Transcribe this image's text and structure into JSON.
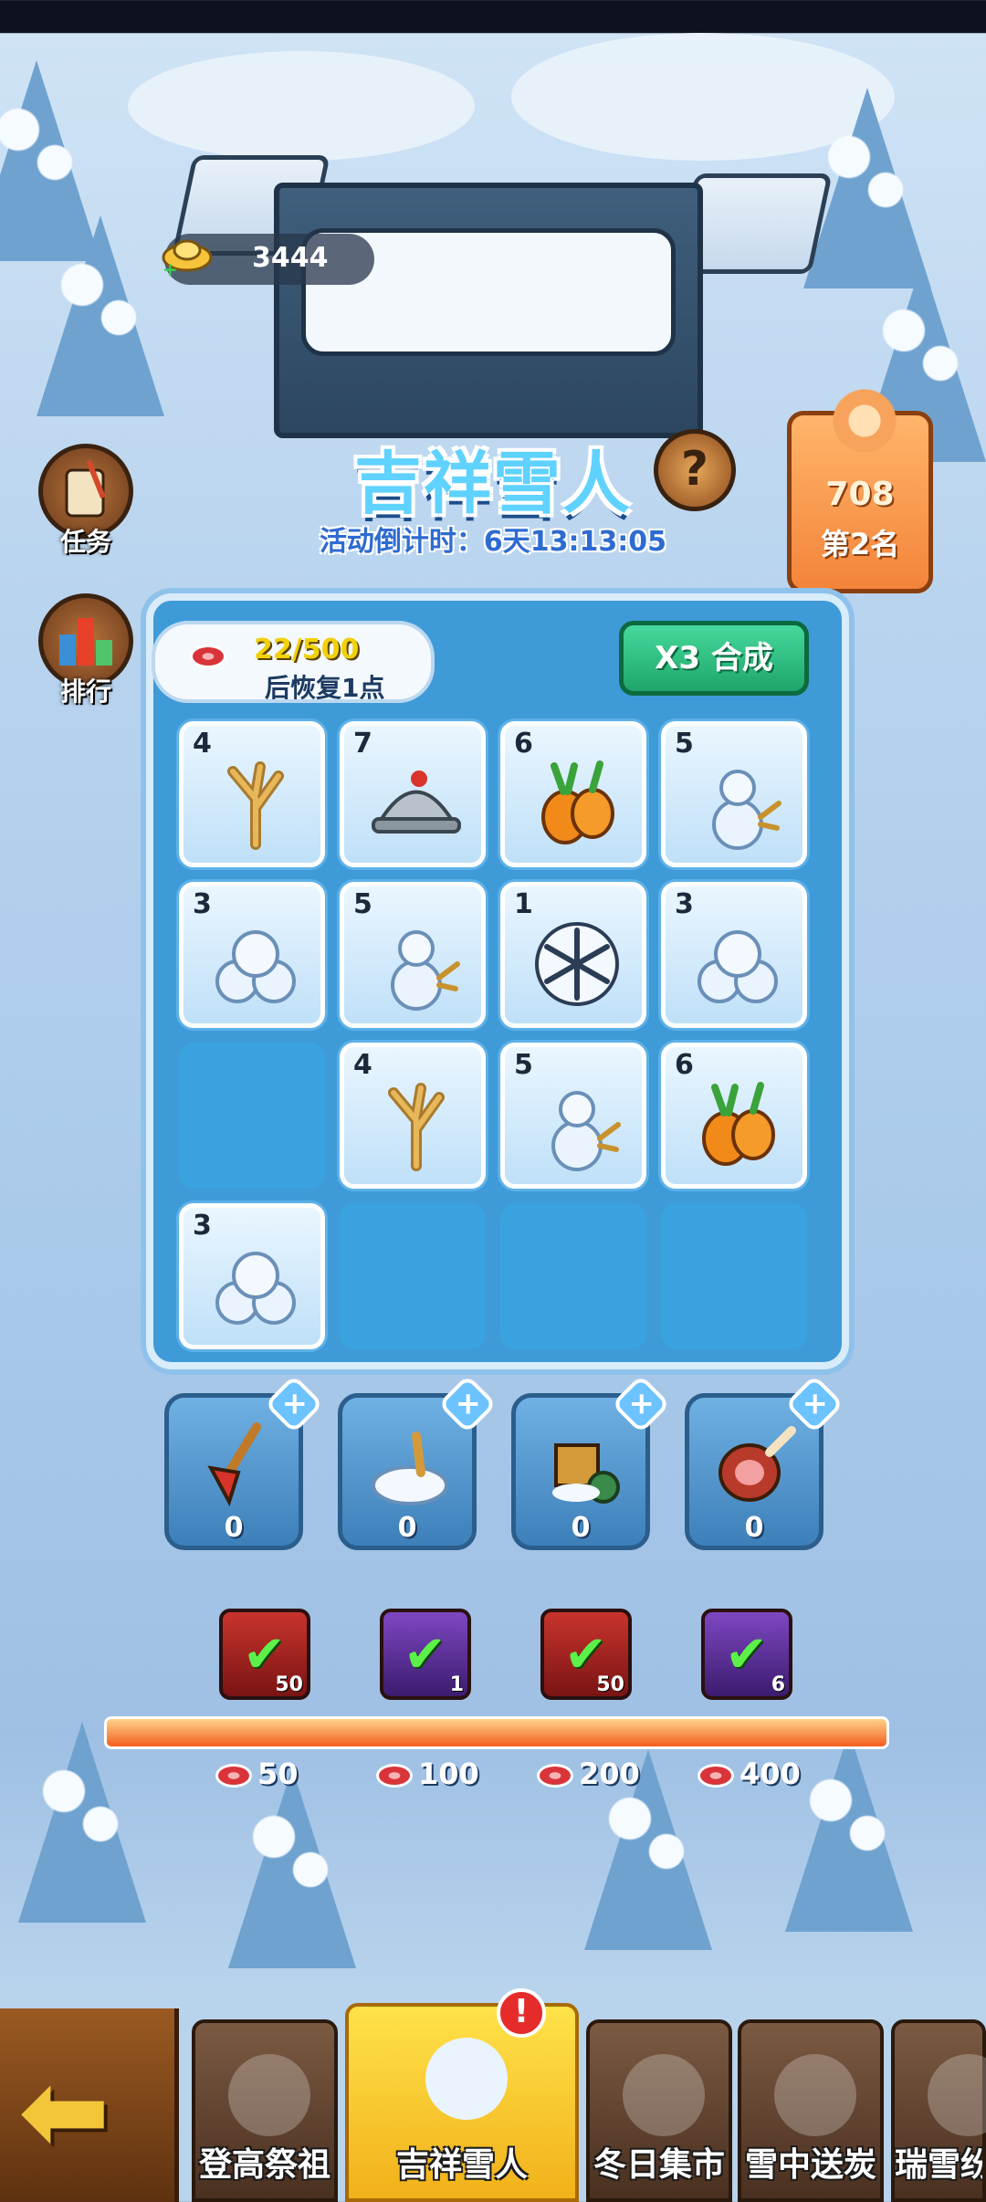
{
  "colors": {
    "title": "#5fd2ff",
    "countdown": "#2e6bd1",
    "merge_button": "#1ea56a",
    "progress_fill": "#f35d1f",
    "active_tab": "#f1b11a"
  },
  "currency": {
    "icon": "gold-ingot-icon",
    "value": "3444"
  },
  "side_buttons": [
    {
      "label": "任务",
      "icon": "scroll-quill-icon"
    },
    {
      "label": "排行",
      "icon": "leaderboard-icon"
    }
  ],
  "event": {
    "title": "吉祥雪人",
    "countdown": "活动倒计时：6天13:13:05",
    "help_glyph": "?"
  },
  "rank": {
    "score": "708",
    "place": "第2名"
  },
  "energy": {
    "icon": "meat-icon",
    "count": "22/500",
    "recover_text": "后恢复1点"
  },
  "merge_button": "X3 合成",
  "grid": [
    {
      "level": "4",
      "item": "branch"
    },
    {
      "level": "7",
      "item": "helmet"
    },
    {
      "level": "6",
      "item": "carrot"
    },
    {
      "level": "5",
      "item": "snowman"
    },
    {
      "level": "3",
      "item": "snowballs"
    },
    {
      "level": "5",
      "item": "snowman"
    },
    {
      "level": "1",
      "item": "snowflake"
    },
    {
      "level": "3",
      "item": "snowballs"
    },
    {
      "level": "",
      "item": ""
    },
    {
      "level": "4",
      "item": "branch"
    },
    {
      "level": "5",
      "item": "snowman"
    },
    {
      "level": "6",
      "item": "carrot"
    },
    {
      "level": "3",
      "item": "snowballs"
    },
    {
      "level": "",
      "item": ""
    },
    {
      "level": "",
      "item": ""
    },
    {
      "level": "",
      "item": ""
    }
  ],
  "tools": [
    {
      "icon": "shovel-icon",
      "count": "0"
    },
    {
      "icon": "snow-scoop-icon",
      "count": "0"
    },
    {
      "icon": "snow-cart-icon",
      "count": "0"
    },
    {
      "icon": "ham-icon",
      "count": "0"
    }
  ],
  "rewards": [
    {
      "color": "red",
      "qty": "50",
      "threshold": "50",
      "claimed": true
    },
    {
      "color": "purple",
      "qty": "1",
      "threshold": "100",
      "claimed": true
    },
    {
      "color": "red",
      "qty": "50",
      "threshold": "200",
      "claimed": true
    },
    {
      "color": "purple",
      "qty": "6",
      "threshold": "400",
      "claimed": true
    }
  ],
  "progress_fraction": 1.0,
  "nav": {
    "back_icon": "back-arrow-icon",
    "tabs": [
      {
        "label": "登高祭祖",
        "icon": "pot-icon"
      },
      {
        "label": "吉祥雪人",
        "icon": "snowman-warrior-icon",
        "active": true,
        "badge": "!"
      },
      {
        "label": "冬日集市",
        "icon": "market-bag-icon"
      },
      {
        "label": "雪中送炭",
        "icon": "campfire-icon"
      },
      {
        "label": "瑞雪纷",
        "icon": "snowflake-icon"
      }
    ]
  }
}
